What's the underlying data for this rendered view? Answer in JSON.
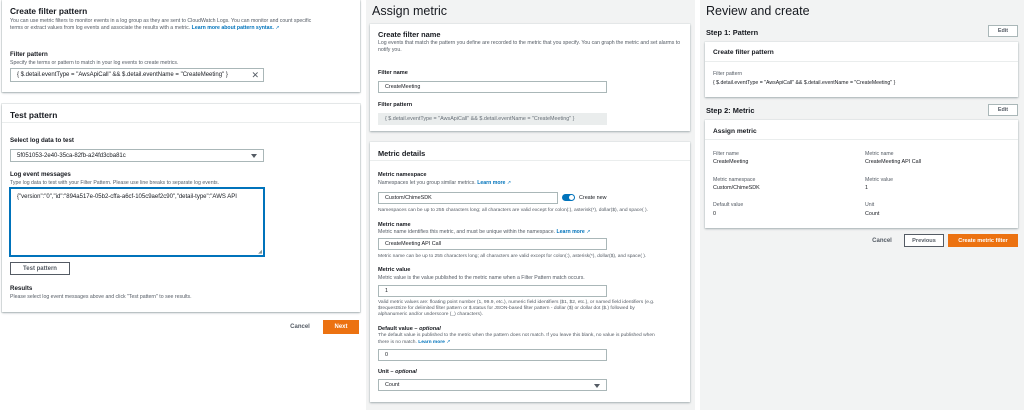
{
  "left": {
    "filter_card": {
      "title": "Create filter pattern",
      "desc_1": "You can use metric filters to monitor events in a log group as they are sent to CloudWatch Logs. You can monitor and count specific",
      "desc_2": "terms or extract values from log events and associate the results with a metric.",
      "learn_more": "Learn more about pattern syntax.",
      "pattern_label": "Filter pattern",
      "pattern_desc": "Specify the terms or pattern to match in your log events to create metrics.",
      "pattern_value": "{ $.detail.eventType = \"AwsApiCall\" && $.detail.eventName = \"CreateMeeting\" }"
    },
    "test_card": {
      "title": "Test pattern",
      "select_label": "Select log data to test",
      "select_value": "5f051053-2e40-35ca-82fb-a24fd3cba81c",
      "messages_label": "Log event messages",
      "messages_desc": "Type log data to test with your Filter Pattern. Please use line breaks to separate log events.",
      "messages_value": "{\"version\":\"0\",\"id\":\"894a517e-05b2-cffa-a6cf-105c9aef2c90\",\"detail-type\":\"AWS API",
      "test_button": "Test pattern",
      "results_label": "Results",
      "results_desc": "Please select log event messages above and click \"Test pattern\" to see results."
    },
    "footer": {
      "cancel": "Cancel",
      "next": "Next"
    }
  },
  "middle": {
    "heading": "Assign metric",
    "filter_name_card": {
      "title": "Create filter name",
      "desc_1": "Log events that match the pattern you define are recorded to the metric that you specify. You can graph the metric and set alarms to",
      "desc_2": "notify you.",
      "name_label": "Filter name",
      "name_value": "CreateMeeting",
      "pattern_label": "Filter pattern",
      "pattern_value": "{ $.detail.eventType = \"AwsApiCall\" && $.detail.eventName = \"CreateMeeting\" }"
    },
    "metric_card": {
      "title": "Metric details",
      "ns_label": "Metric namespace",
      "ns_desc": "Namespaces let you group similar metrics.",
      "learn_more": "Learn more",
      "ns_value": "Custom/ChimeSDK",
      "toggle_label": "Create new",
      "ns_hint": "Namespaces can be up to 255 characters long; all characters are valid except for colon(:), asterisk(*), dollar($), and space( ).",
      "name_label": "Metric name",
      "name_desc": "Metric name identifies this metric, and must be unique within the namespace.",
      "name_value": "CreateMeeting API Call",
      "name_hint": "Metric name can be up to 255 characters long; all characters are valid except for colon(:), asterisk(*), dollar($), and space( ).",
      "value_label": "Metric value",
      "value_desc": "Metric value is the value published to the metric name when a Filter Pattern match occurs.",
      "value_value": "1",
      "value_hint_1": "Valid metric values are: floating point number (1, 99.9, etc.), numeric field identifiers ($1, $2, etc.), or named field identifiers (e.g.",
      "value_hint_2": "$requestSize for delimited filter pattern or $.status for JSON-based filter pattern - dollar ($) or dollar dot ($.) followed by",
      "value_hint_3": "alphanumeric and/or underscore (_) characters).",
      "default_label": "Default value",
      "optional": "optional",
      "default_desc_1": "The default value is published to the metric when the pattern does not match. If you leave this blank, no value is published when",
      "default_desc_2": "there is no match.",
      "default_value": "0",
      "unit_label": "Unit",
      "unit_value": "Count"
    }
  },
  "right": {
    "heading": "Review and create",
    "step1": "Step 1: Pattern",
    "step2": "Step 2: Metric",
    "edit": "Edit",
    "pattern_card": {
      "title": "Create filter pattern",
      "pattern_label": "Filter pattern",
      "pattern_value": "{ $.detail.eventType = \"AwsApiCall\" && $.detail.eventName = \"CreateMeeting\" }"
    },
    "metric_card": {
      "title": "Assign metric",
      "filter_name_label": "Filter name",
      "filter_name_value": "CreateMeeting",
      "metric_name_label": "Metric name",
      "metric_name_value": "CreateMeeting API Call",
      "ns_label": "Metric namespace",
      "ns_value": "Custom/ChimeSDK",
      "metric_value_label": "Metric value",
      "metric_value_value": "1",
      "default_label": "Default value",
      "default_value": "0",
      "unit_label": "Unit",
      "unit_value": "Count"
    },
    "footer": {
      "cancel": "Cancel",
      "previous": "Previous",
      "create": "Create metric filter"
    }
  }
}
